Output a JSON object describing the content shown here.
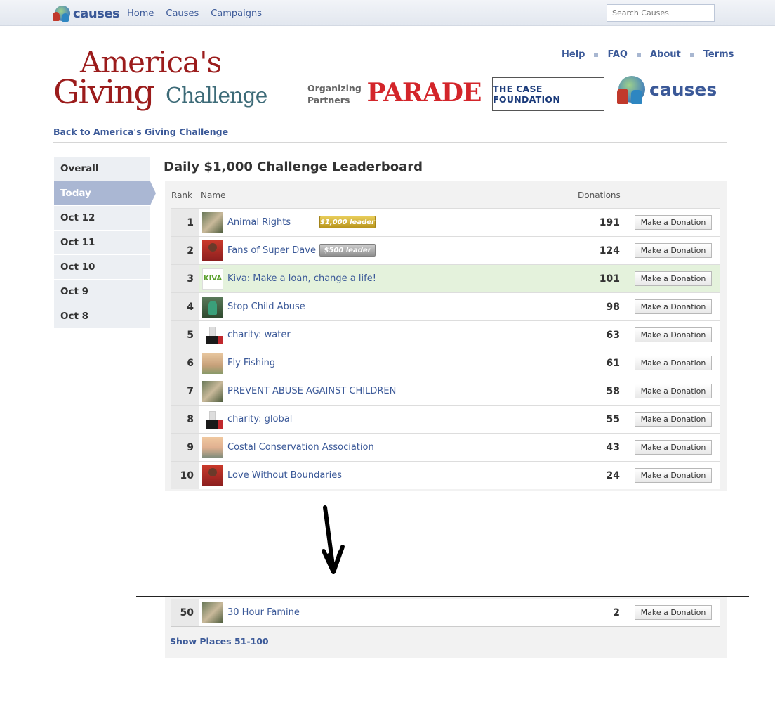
{
  "topbar": {
    "logo_text": "causes",
    "nav": [
      "Home",
      "Causes",
      "Campaigns"
    ],
    "search_placeholder": "Search Causes"
  },
  "header": {
    "brand_line1": "America's",
    "brand_line2": "Giving",
    "brand_line3": "Challenge",
    "links": [
      "Help",
      "FAQ",
      "About",
      "Terms"
    ],
    "organizing_label_1": "Organizing",
    "organizing_label_2": "Partners",
    "partner_parade": "PARADE",
    "partner_case": "THE CASE FOUNDATION",
    "partner_causes": "causes",
    "back_link": "Back to America's Giving Challenge"
  },
  "menu": {
    "items": [
      "Overall",
      "Today",
      "Oct 12",
      "Oct 11",
      "Oct 10",
      "Oct 9",
      "Oct 8"
    ],
    "active": "Today"
  },
  "leaderboard": {
    "title": "Daily $1,000 Challenge Leaderboard",
    "col_rank": "Rank",
    "col_name": "Name",
    "col_donations": "Donations",
    "button_label": "Make a Donation",
    "rows": [
      {
        "rank": "1",
        "name": "Animal Rights",
        "donations": "191",
        "badge": "$1,000 leader"
      },
      {
        "rank": "2",
        "name": "Fans of Super Dave",
        "donations": "124",
        "badge": "$500 leader"
      },
      {
        "rank": "3",
        "name": "Kiva: Make a loan, change a life!",
        "donations": "101"
      },
      {
        "rank": "4",
        "name": "Stop Child Abuse",
        "donations": "98"
      },
      {
        "rank": "5",
        "name": "charity: water",
        "donations": "63"
      },
      {
        "rank": "6",
        "name": "Fly Fishing",
        "donations": "61"
      },
      {
        "rank": "7",
        "name": "PREVENT ABUSE AGAINST CHILDREN",
        "donations": "58"
      },
      {
        "rank": "8",
        "name": "charity: global",
        "donations": "55"
      },
      {
        "rank": "9",
        "name": "Costal Conservation Association",
        "donations": "43"
      },
      {
        "rank": "10",
        "name": "Love Without Boundaries",
        "donations": "24"
      }
    ],
    "row50": {
      "rank": "50",
      "name": "30 Hour Famine",
      "donations": "2"
    },
    "show_more": "Show Places 51-100",
    "kiva_thumb_text": "KIVA"
  },
  "colors": {
    "link": "#3b5998",
    "active_menu": "#aab7d3",
    "highlight_row": "#e4f2dc"
  },
  "icons": [
    "causes-globe-icon",
    "down-arrow-icon"
  ]
}
